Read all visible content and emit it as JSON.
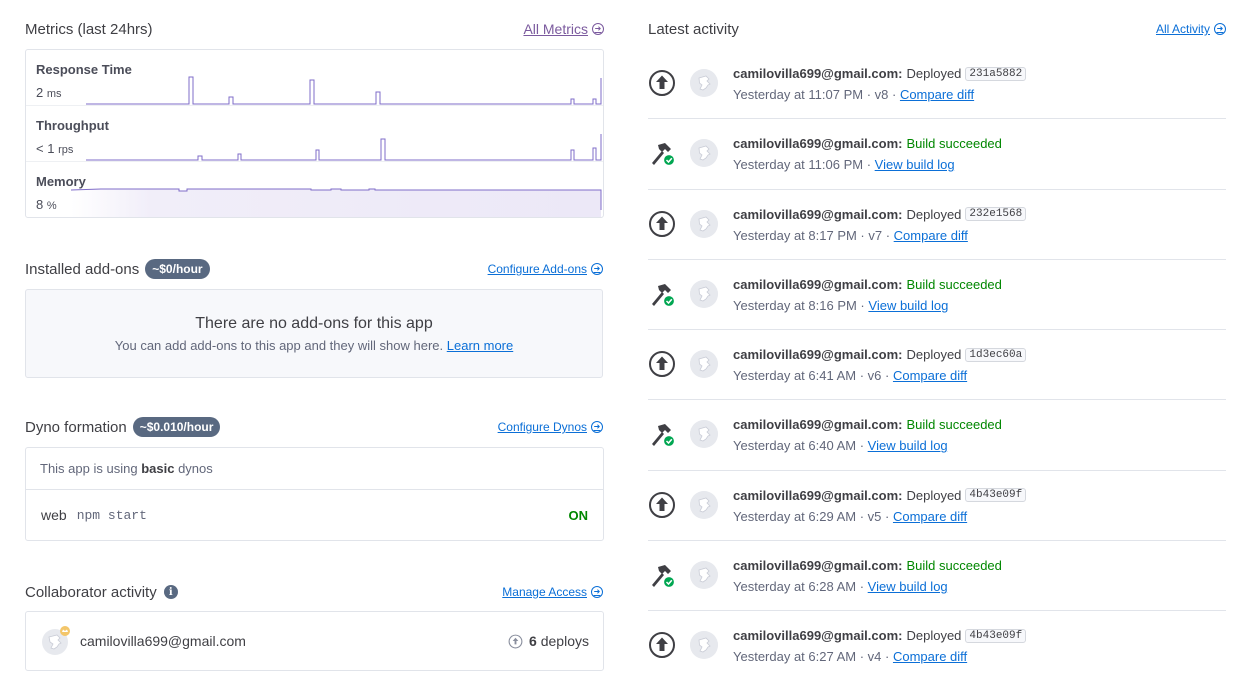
{
  "metrics": {
    "title": "Metrics (last 24hrs)",
    "all_link": "All Metrics",
    "rows": [
      {
        "label": "Response Time",
        "value": "2",
        "unit": "ms"
      },
      {
        "label": "Throughput",
        "value": "< 1",
        "unit": "rps"
      },
      {
        "label": "Memory",
        "value": "8",
        "unit": "%"
      }
    ],
    "accent": "#7f6cc8"
  },
  "addons": {
    "title": "Installed add-ons",
    "cost": "~$0/hour",
    "configure_link": "Configure Add-ons",
    "empty_title": "There are no add-ons for this app",
    "empty_sub": "You can add add-ons to this app and they will show here.",
    "learn_more": "Learn more"
  },
  "dyno": {
    "title": "Dyno formation",
    "cost": "~$0.010/hour",
    "configure_link": "Configure Dynos",
    "info_prefix": "This app is using",
    "info_type": "basic",
    "info_suffix": "dynos",
    "process": {
      "name": "web",
      "command": "npm start",
      "state": "ON"
    }
  },
  "collaborators": {
    "title": "Collaborator activity",
    "manage_link": "Manage Access",
    "email": "camilovilla699@gmail.com",
    "deploy_count": "6",
    "deploy_label": "deploys"
  },
  "activity": {
    "title": "Latest activity",
    "all_link": "All Activity",
    "items": [
      {
        "kind": "deploy",
        "email": "camilovilla699@gmail.com:",
        "verb": "Deployed",
        "hash": "231a5882",
        "time": "Yesterday at 11:07 PM · v8 ·",
        "link": "Compare diff"
      },
      {
        "kind": "build",
        "email": "camilovilla699@gmail.com:",
        "verb": "Build succeeded",
        "time": "Yesterday at 11:06 PM ·",
        "link": "View build log"
      },
      {
        "kind": "deploy",
        "email": "camilovilla699@gmail.com:",
        "verb": "Deployed",
        "hash": "232e1568",
        "time": "Yesterday at 8:17 PM · v7 ·",
        "link": "Compare diff"
      },
      {
        "kind": "build",
        "email": "camilovilla699@gmail.com:",
        "verb": "Build succeeded",
        "time": "Yesterday at 8:16 PM ·",
        "link": "View build log"
      },
      {
        "kind": "deploy",
        "email": "camilovilla699@gmail.com:",
        "verb": "Deployed",
        "hash": "1d3ec60a",
        "time": "Yesterday at 6:41 AM · v6 ·",
        "link": "Compare diff"
      },
      {
        "kind": "build",
        "email": "camilovilla699@gmail.com:",
        "verb": "Build succeeded",
        "time": "Yesterday at 6:40 AM ·",
        "link": "View build log"
      },
      {
        "kind": "deploy",
        "email": "camilovilla699@gmail.com:",
        "verb": "Deployed",
        "hash": "4b43e09f",
        "time": "Yesterday at 6:29 AM · v5 ·",
        "link": "Compare diff"
      },
      {
        "kind": "build",
        "email": "camilovilla699@gmail.com:",
        "verb": "Build succeeded",
        "time": "Yesterday at 6:28 AM ·",
        "link": "View build log"
      },
      {
        "kind": "deploy",
        "email": "camilovilla699@gmail.com:",
        "verb": "Deployed",
        "hash": "4b43e09f",
        "time": "Yesterday at 6:27 AM · v4 ·",
        "link": "Compare diff"
      }
    ]
  }
}
